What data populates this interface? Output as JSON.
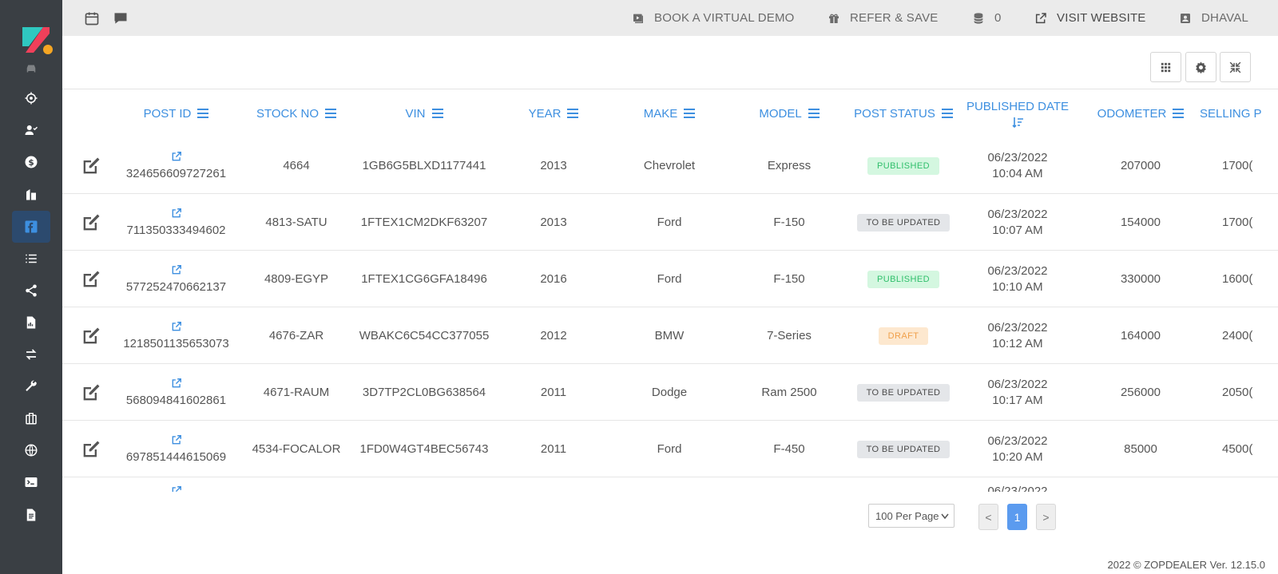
{
  "topbar": {
    "demo_label": "BOOK A VIRTUAL DEMO",
    "refer_label": "REFER & SAVE",
    "credits_count": "0",
    "visit_label": "VISIT WEBSITE",
    "user_label": "DHAVAL"
  },
  "table": {
    "headers": {
      "post_id": "POST ID",
      "stock_no": "STOCK NO",
      "vin": "VIN",
      "year": "YEAR",
      "make": "MAKE",
      "model": "MODEL",
      "post_status": "POST STATUS",
      "published_date": "PUBLISHED DATE",
      "odometer": "ODOMETER",
      "selling_price": "SELLING P"
    },
    "rows": [
      {
        "post_id": "324656609727261",
        "stock_no": "4664",
        "vin": "1GB6G5BLXD1177441",
        "year": "2013",
        "make": "Chevrolet",
        "model": "Express",
        "status": "PUBLISHED",
        "date": "06/23/2022",
        "time": "10:04 AM",
        "odometer": "207000",
        "price": "1700("
      },
      {
        "post_id": "711350333494602",
        "stock_no": "4813-SATU",
        "vin": "1FTEX1CM2DKF63207",
        "year": "2013",
        "make": "Ford",
        "model": "F-150",
        "status": "TO BE UPDATED",
        "date": "06/23/2022",
        "time": "10:07 AM",
        "odometer": "154000",
        "price": "1700("
      },
      {
        "post_id": "577252470662137",
        "stock_no": "4809-EGYP",
        "vin": "1FTEX1CG6GFA18496",
        "year": "2016",
        "make": "Ford",
        "model": "F-150",
        "status": "PUBLISHED",
        "date": "06/23/2022",
        "time": "10:10 AM",
        "odometer": "330000",
        "price": "1600("
      },
      {
        "post_id": "1218501135653073",
        "stock_no": "4676-ZAR",
        "vin": "WBAKC6C54CC377055",
        "year": "2012",
        "make": "BMW",
        "model": "7-Series",
        "status": "DRAFT",
        "date": "06/23/2022",
        "time": "10:12 AM",
        "odometer": "164000",
        "price": "2400("
      },
      {
        "post_id": "568094841602861",
        "stock_no": "4671-RAUM",
        "vin": "3D7TP2CL0BG638564",
        "year": "2011",
        "make": "Dodge",
        "model": "Ram 2500",
        "status": "TO BE UPDATED",
        "date": "06/23/2022",
        "time": "10:17 AM",
        "odometer": "256000",
        "price": "2050("
      },
      {
        "post_id": "697851444615069",
        "stock_no": "4534-FOCALOR",
        "vin": "1FD0W4GT4BEC56743",
        "year": "2011",
        "make": "Ford",
        "model": "F-450",
        "status": "TO BE UPDATED",
        "date": "06/23/2022",
        "time": "10:20 AM",
        "odometer": "85000",
        "price": "4500("
      },
      {
        "post_id": "",
        "stock_no": "",
        "vin": "",
        "year": "",
        "make": "",
        "model": "",
        "status": "",
        "date": "06/23/2022",
        "time": "",
        "odometer": "",
        "price": ""
      }
    ]
  },
  "pagination": {
    "per_page": "100 Per Page",
    "prev": "<",
    "current": "1",
    "next": ">"
  },
  "footer": "2022 © ZOPDEALER Ver. 12.15.0",
  "colors": {
    "sidebar": "#3a3f44",
    "accent": "#3d8fe0",
    "published": "#2fbf6b",
    "draft": "#f0a04b"
  }
}
